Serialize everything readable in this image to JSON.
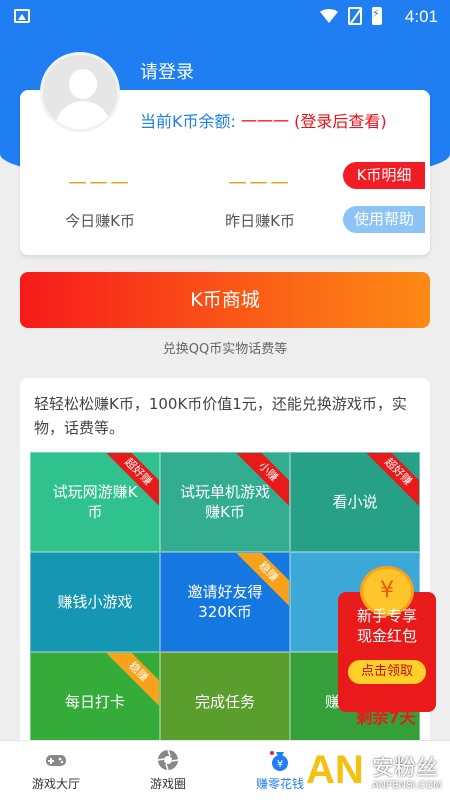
{
  "status_bar": {
    "time": "4:01"
  },
  "header": {
    "login_text": "请登录",
    "balance_label": "当前K币余额: ",
    "balance_value": "一一一 (登录后查看)"
  },
  "stats": {
    "today_value": "一一一",
    "today_label": "今日赚K币",
    "yesterday_value": "一一一",
    "yesterday_label": "昨日赚K币",
    "detail_button": "K币明细",
    "help_button": "使用帮助"
  },
  "mall": {
    "button": "K币商城",
    "subtitle": "兑换QQ币实物话费等"
  },
  "panel": {
    "description": "轻轻松松赚K币，100K币价值1元，还能兑换游戏币，实物，话费等。",
    "tiles": [
      {
        "label": "试玩网游赚K币",
        "ribbon": "超好赚",
        "color": "#2fc28f"
      },
      {
        "label": "试玩单机游戏赚K币",
        "ribbon": "小赚",
        "color": "#33ad90"
      },
      {
        "label": "看小说",
        "ribbon": "超好赚",
        "color": "#27a088"
      },
      {
        "label": "赚钱小游戏",
        "ribbon": "",
        "color": "#1596b2"
      },
      {
        "label": "邀请好友得320K币",
        "ribbon": "稳赚",
        "color": "#1578e0"
      },
      {
        "label": "",
        "ribbon": "",
        "color": "#3ba8d8"
      },
      {
        "label": "每日打卡",
        "ribbon": "稳赚",
        "color": "#35ac3a"
      },
      {
        "label": "完成任务",
        "ribbon": "",
        "color": "#5a9e2d"
      },
      {
        "label": "赚钱活动",
        "ribbon": "",
        "color": "#35a03a"
      }
    ]
  },
  "red_packet": {
    "title_line1": "新手专享",
    "title_line2": "现金红包",
    "button": "点击领取",
    "remaining": "剩余7天",
    "coin_symbol": "¥"
  },
  "tabbar": {
    "tabs": [
      {
        "label": "游戏大厅",
        "icon": "gamepad-icon"
      },
      {
        "label": "游戏圈",
        "icon": "aperture-icon"
      },
      {
        "label": "赚零花钱",
        "icon": "moneybag-icon"
      }
    ]
  },
  "watermark": {
    "an": "AN",
    "cn": "安粉丝",
    "en": "ANFENSI.COM"
  },
  "colors": {
    "primary": "#1e7ef2",
    "accent_red": "#e8101a",
    "dash_orange": "#f0a020"
  }
}
